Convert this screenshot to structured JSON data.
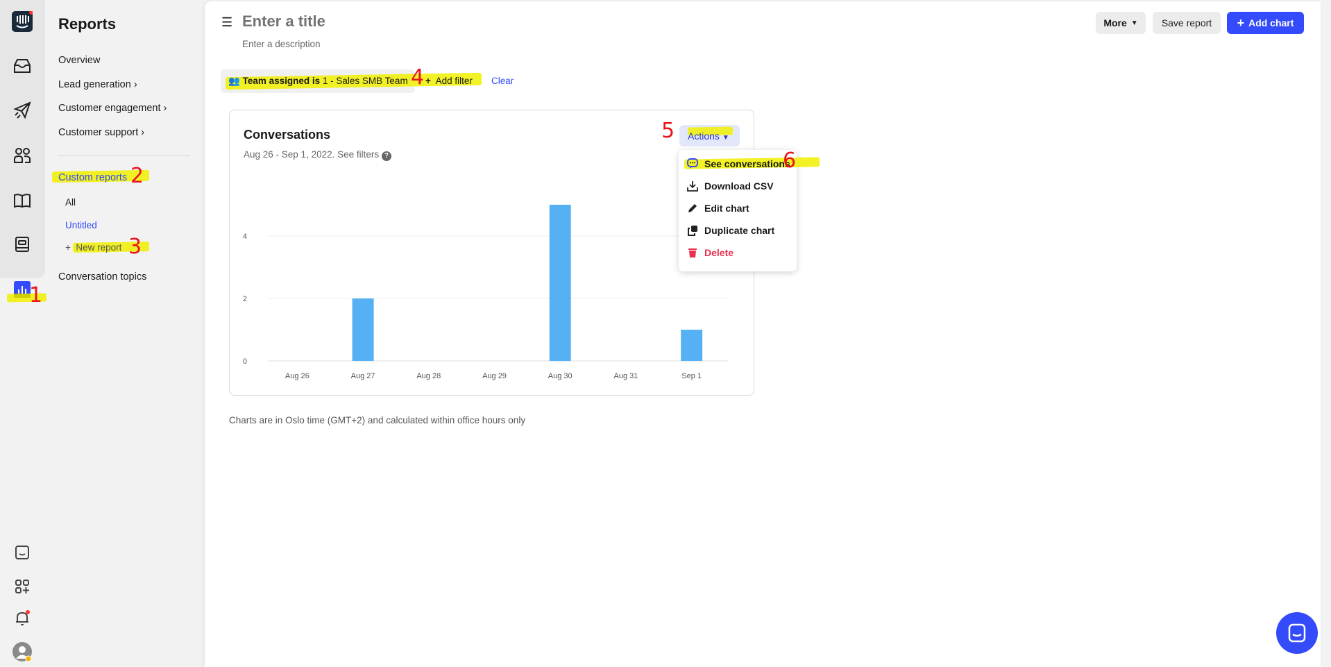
{
  "sidebar": {
    "title": "Reports",
    "items": [
      {
        "label": "Overview"
      },
      {
        "label": "Lead generation"
      },
      {
        "label": "Customer engagement"
      },
      {
        "label": "Customer support"
      }
    ],
    "custom_reports": "Custom reports",
    "all": "All",
    "untitled": "Untitled",
    "new_report": "New report",
    "conversation_topics": "Conversation topics"
  },
  "header": {
    "title_placeholder": "Enter a title",
    "description_placeholder": "Enter a description",
    "more": "More",
    "save": "Save report",
    "add_chart": "Add chart"
  },
  "filters": {
    "chip_bold": "Team assigned is",
    "chip_value": "1 - Sales SMB Team",
    "add_filter": "Add filter",
    "clear": "Clear"
  },
  "card": {
    "title": "Conversations",
    "subtitle": "Aug 26 - Sep 1, 2022. See filters",
    "actions": "Actions",
    "menu": [
      {
        "label": "See conversations",
        "icon": "chat-icon"
      },
      {
        "label": "Download CSV",
        "icon": "download-icon"
      },
      {
        "label": "Edit chart",
        "icon": "pencil-icon"
      },
      {
        "label": "Duplicate chart",
        "icon": "duplicate-icon"
      },
      {
        "label": "Delete",
        "icon": "trash-icon",
        "color": "#e8304f"
      }
    ]
  },
  "chart_data": {
    "type": "bar",
    "categories": [
      "Aug 26",
      "Aug 27",
      "Aug 28",
      "Aug 29",
      "Aug 30",
      "Aug 31",
      "Sep 1"
    ],
    "values": [
      0,
      2,
      0,
      0,
      5,
      0,
      1
    ],
    "yticks": [
      "0",
      "2",
      "4"
    ],
    "ylim": [
      0,
      5
    ],
    "grid": true,
    "color": "#55b1f3"
  },
  "footer_note": "Charts are in Oslo time (GMT+2) and calculated within office hours only",
  "annotations": [
    "1",
    "2",
    "3",
    "4",
    "5",
    "6"
  ],
  "colors": {
    "accent": "#334bfa",
    "highlight": "#f0f000",
    "annotation": "#e8141d"
  }
}
